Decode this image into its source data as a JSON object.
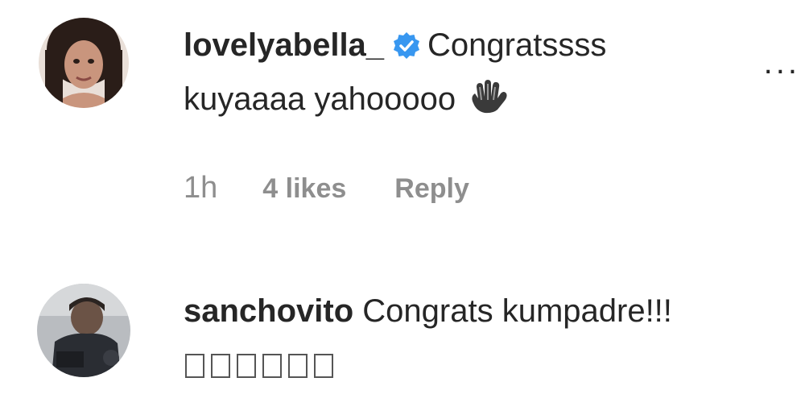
{
  "comments": [
    {
      "username": "lovelyabella_",
      "verified": true,
      "text_line1": "Congratssss",
      "text_line2": "kuyaaaa yahooooo",
      "emoji": "waving-hand",
      "time": "1h",
      "likes": "4 likes",
      "reply": "Reply",
      "more": "..."
    },
    {
      "username": "sanchovito",
      "verified": false,
      "text_line1": "Congrats kumpadre!!!",
      "text_line2": "□□□□□□"
    }
  ],
  "colors": {
    "text": "#262626",
    "meta": "#8e8e8e",
    "verified": "#3897f0"
  }
}
